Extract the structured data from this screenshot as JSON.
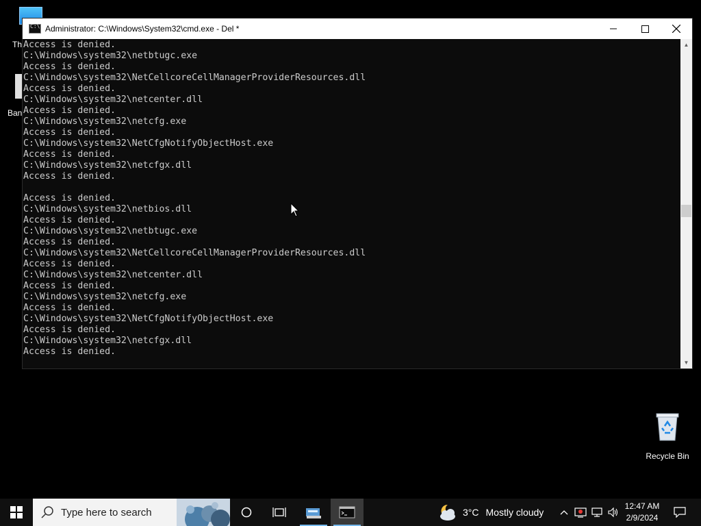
{
  "desktop": {
    "icons": [
      {
        "label": "Th"
      },
      {
        "label": "Ban"
      }
    ],
    "recycle_bin": {
      "label": "Recycle Bin"
    }
  },
  "window": {
    "title": "Administrator: C:\\Windows\\System32\\cmd.exe - Del  *",
    "controls": {
      "minimize": "minimize",
      "maximize": "maximize",
      "close": "close"
    }
  },
  "console": {
    "lines": [
      "Access is denied.",
      "C:\\Windows\\system32\\netbtugc.exe",
      "Access is denied.",
      "C:\\Windows\\system32\\NetCellcoreCellManagerProviderResources.dll",
      "Access is denied.",
      "C:\\Windows\\system32\\netcenter.dll",
      "Access is denied.",
      "C:\\Windows\\system32\\netcfg.exe",
      "Access is denied.",
      "C:\\Windows\\system32\\NetCfgNotifyObjectHost.exe",
      "Access is denied.",
      "C:\\Windows\\system32\\netcfgx.dll",
      "Access is denied.",
      "",
      "Access is denied.",
      "C:\\Windows\\system32\\netbios.dll",
      "Access is denied.",
      "C:\\Windows\\system32\\netbtugc.exe",
      "Access is denied.",
      "C:\\Windows\\system32\\NetCellcoreCellManagerProviderResources.dll",
      "Access is denied.",
      "C:\\Windows\\system32\\netcenter.dll",
      "Access is denied.",
      "C:\\Windows\\system32\\netcfg.exe",
      "Access is denied.",
      "C:\\Windows\\system32\\NetCfgNotifyObjectHost.exe",
      "Access is denied.",
      "C:\\Windows\\system32\\netcfgx.dll",
      "Access is denied."
    ]
  },
  "taskbar": {
    "search_placeholder": "Type here to search",
    "weather": {
      "temp": "3°C",
      "condition": "Mostly cloudy"
    },
    "clock": {
      "time": "12:47 AM",
      "date": "2/9/2024"
    }
  },
  "colors": {
    "console_bg": "#0c0c0c",
    "console_fg": "#cccccc",
    "taskbar_bg": "#101010",
    "accent": "#76b9ed"
  }
}
